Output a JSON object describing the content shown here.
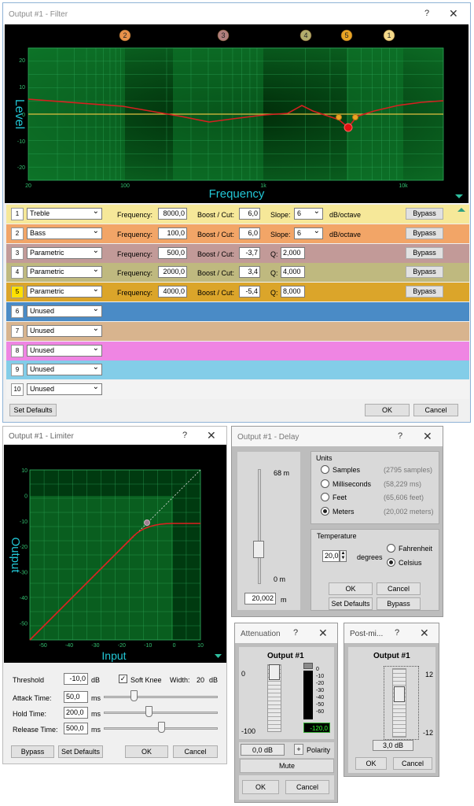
{
  "filter": {
    "title": "Output #1 - Filter",
    "band_markers": [
      "2",
      "3",
      "4",
      "5",
      "1"
    ],
    "y_label": "Level",
    "x_label": "Frequency",
    "y_ticks": [
      "20",
      "10",
      "0",
      "-10",
      "-20"
    ],
    "x_ticks": [
      "20",
      "100",
      "1k",
      "10k"
    ],
    "labels": {
      "frequency": "Frequency:",
      "boost": "Boost / Cut:",
      "slope": "Slope:",
      "q": "Q:",
      "dboct": "dB/octave",
      "bypass": "Bypass"
    },
    "bands": [
      {
        "num": "1",
        "type": "Treble",
        "freq": "8000,0",
        "boost": "6,0",
        "slope": "6"
      },
      {
        "num": "2",
        "type": "Bass",
        "freq": "100,0",
        "boost": "6,0",
        "slope": "6"
      },
      {
        "num": "3",
        "type": "Parametric",
        "freq": "500,0",
        "boost": "-3,7",
        "q": "2,000"
      },
      {
        "num": "4",
        "type": "Parametric",
        "freq": "2000,0",
        "boost": "3,4",
        "q": "4,000"
      },
      {
        "num": "5",
        "type": "Parametric",
        "freq": "4000,0",
        "boost": "-5,4",
        "q": "8,000"
      },
      {
        "num": "6",
        "type": "Unused"
      },
      {
        "num": "7",
        "type": "Unused"
      },
      {
        "num": "8",
        "type": "Unused"
      },
      {
        "num": "9",
        "type": "Unused"
      },
      {
        "num": "10",
        "type": "Unused"
      }
    ],
    "set_defaults": "Set Defaults",
    "ok": "OK",
    "cancel": "Cancel"
  },
  "limiter": {
    "title": "Output #1 - Limiter",
    "y_label": "Output",
    "x_label": "Input",
    "y_ticks": [
      "10",
      "0",
      "-10",
      "-20",
      "-30",
      "-40",
      "-50"
    ],
    "x_ticks": [
      "-50",
      "-40",
      "-30",
      "-20",
      "-10",
      "0",
      "10"
    ],
    "threshold_label": "Threshold",
    "threshold_value": "-10,0",
    "db": "dB",
    "soft_knee": "Soft Knee",
    "width_label": "Width:",
    "width_value": "20",
    "width_unit": "dB",
    "attack_label": "Attack Time:",
    "attack_value": "50,0",
    "ms": "ms",
    "attack_pos": 0.26,
    "hold_label": "Hold Time:",
    "hold_value": "200,0",
    "hold_pos": 0.39,
    "release_label": "Release Time:",
    "release_value": "500,0",
    "release_pos": 0.5,
    "bypass": "Bypass",
    "set_defaults": "Set Defaults",
    "ok": "OK",
    "cancel": "Cancel"
  },
  "delay": {
    "title": "Output #1 - Delay",
    "max": "68 m",
    "min": "0 m",
    "value": "20,002",
    "unit": "m",
    "units_title": "Units",
    "units": [
      {
        "label": "Samples",
        "info": "(2795 samples)",
        "checked": false
      },
      {
        "label": "Milliseconds",
        "info": "(58,229 ms)",
        "checked": false
      },
      {
        "label": "Feet",
        "info": "(65,606 feet)",
        "checked": false
      },
      {
        "label": "Meters",
        "info": "(20,002 meters)",
        "checked": true
      }
    ],
    "temp_title": "Temperature",
    "temp_value": "20,0",
    "degrees": "degrees",
    "fahrenheit": "Fahrenheit",
    "celsius": "Celsius",
    "ok": "OK",
    "cancel": "Cancel",
    "set_defaults": "Set Defaults",
    "bypass": "Bypass"
  },
  "attenuation": {
    "title": "Attenuation",
    "channel": "Output #1",
    "max": "0",
    "min": "-100",
    "meter_ticks": [
      "0",
      "-10",
      "-20",
      "-30",
      "-40",
      "-50",
      "-60"
    ],
    "meter_value": "-120,0",
    "value": "0,0 dB",
    "plus": "+",
    "polarity": "Polarity",
    "mute": "Mute",
    "ok": "OK",
    "cancel": "Cancel"
  },
  "postmix": {
    "title": "Post-mi...",
    "channel": "Output #1",
    "max": "12",
    "min": "-12",
    "value": "3,0 dB",
    "ok": "OK",
    "cancel": "Cancel"
  },
  "colors": {
    "band1": "#f6e899",
    "band2": "#f2a567",
    "band3": "#c29a98",
    "band4": "#bfb97f",
    "band5": "#dba52a",
    "band6": "#4a8bc6",
    "band7": "#d8b48e",
    "band8": "#ef85e3",
    "band9": "#83cde8",
    "band10": "#f3f3f3",
    "marker1": "#f4d98a",
    "marker2": "#e8914a",
    "marker3": "#b07f7d",
    "marker4": "#b3ad6d",
    "marker5": "#e9a424"
  }
}
